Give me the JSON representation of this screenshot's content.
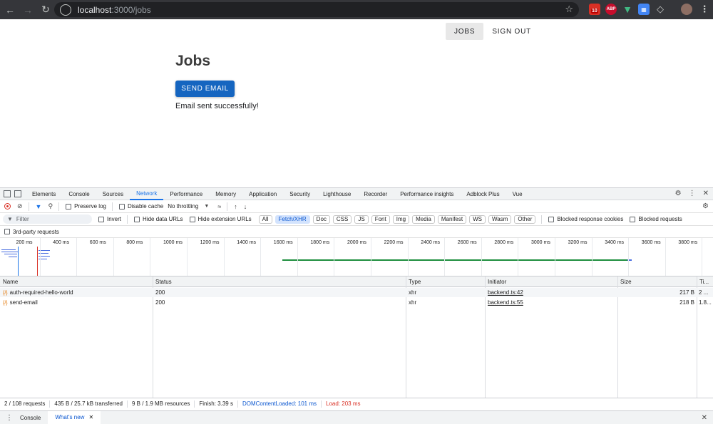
{
  "browser": {
    "url_host": "localhost",
    "url_path": ":3000/jobs",
    "calendar_badge": "10",
    "abp_label": "ABP"
  },
  "page": {
    "nav": {
      "jobs": "JOBS",
      "sign_out": "SIGN OUT"
    },
    "title": "Jobs",
    "send_button": "SEND EMAIL",
    "message": "Email sent successfully!"
  },
  "devtools": {
    "tabs": [
      "Elements",
      "Console",
      "Sources",
      "Network",
      "Performance",
      "Memory",
      "Application",
      "Security",
      "Lighthouse",
      "Recorder",
      "Performance insights",
      "Adblock Plus",
      "Vue"
    ],
    "active_tab": "Network",
    "toolbar": {
      "preserve_log": "Preserve log",
      "disable_cache": "Disable cache",
      "throttling": "No throttling"
    },
    "filter": {
      "placeholder": "Filter",
      "invert": "Invert",
      "hide_data_urls": "Hide data URLs",
      "hide_extension_urls": "Hide extension URLs",
      "chips": [
        "All",
        "Fetch/XHR",
        "Doc",
        "CSS",
        "JS",
        "Font",
        "Img",
        "Media",
        "Manifest",
        "WS",
        "Wasm",
        "Other"
      ],
      "active_chip": "Fetch/XHR",
      "blocked_cookies": "Blocked response cookies",
      "blocked_requests": "Blocked requests",
      "third_party": "3rd-party requests"
    },
    "timeline_ticks": [
      "200 ms",
      "400 ms",
      "600 ms",
      "800 ms",
      "1000 ms",
      "1200 ms",
      "1400 ms",
      "1600 ms",
      "1800 ms",
      "2000 ms",
      "2200 ms",
      "2400 ms",
      "2600 ms",
      "2800 ms",
      "3000 ms",
      "3200 ms",
      "3400 ms",
      "3600 ms",
      "3800 ms"
    ],
    "columns": {
      "name": "Name",
      "status": "Status",
      "type": "Type",
      "initiator": "Initiator",
      "size": "Size",
      "time": "Ti..."
    },
    "rows": [
      {
        "name": "auth-required-hello-world",
        "status": "200",
        "type": "xhr",
        "initiator": "backend.ts:42",
        "size": "217 B",
        "time": "2 ..."
      },
      {
        "name": "send-email",
        "status": "200",
        "type": "xhr",
        "initiator": "backend.ts:55",
        "size": "218 B",
        "time": "1.8..."
      }
    ],
    "status": {
      "requests": "2 / 108 requests",
      "transferred": "435 B / 25.7 kB transferred",
      "resources": "9 B / 1.9 MB resources",
      "finish": "Finish: 3.39 s",
      "dcl": "DOMContentLoaded: 101 ms",
      "load": "Load: 203 ms"
    },
    "drawer": {
      "console": "Console",
      "whats_new": "What's new"
    }
  }
}
